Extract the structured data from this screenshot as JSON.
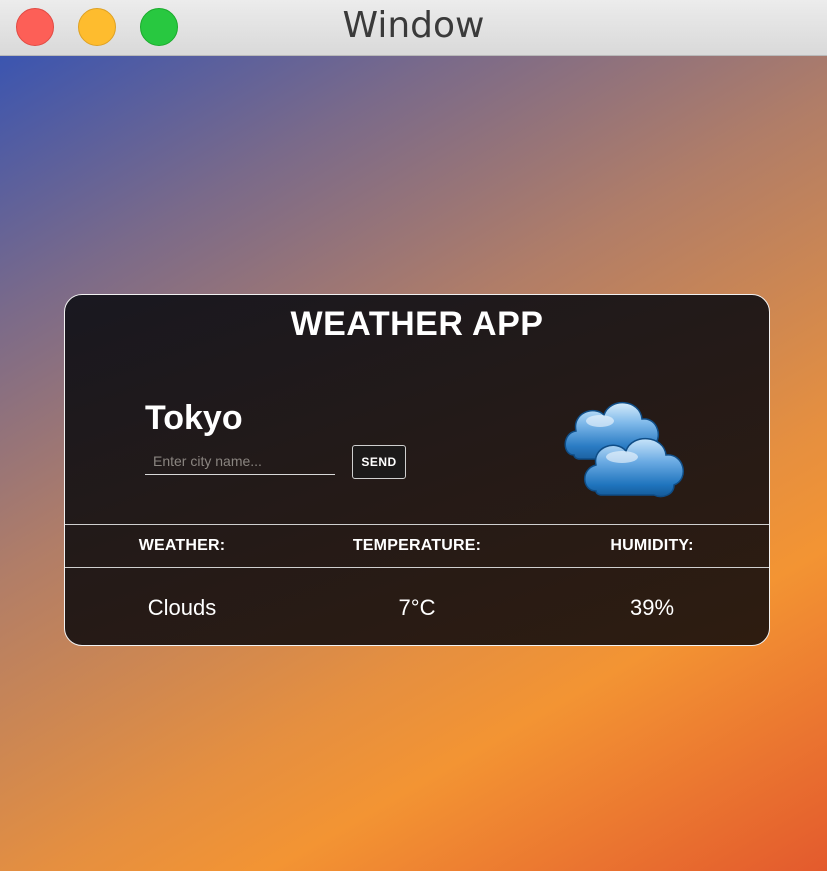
{
  "window": {
    "title": "Window"
  },
  "app": {
    "title": "WEATHER APP",
    "city": "Tokyo",
    "input_placeholder": "Enter city name...",
    "input_value": "",
    "send_label": "SEND",
    "weather_icon": "clouds-icon",
    "table": {
      "headers": [
        "WEATHER:",
        "TEMPERATURE:",
        "HUMIDITY:"
      ],
      "values": [
        "Clouds",
        "7°C",
        "39%"
      ]
    }
  },
  "colors": {
    "traffic_close": "#fd5f57",
    "traffic_minimize": "#febc2e",
    "traffic_maximize": "#28c840",
    "card_border": "#f2f2f2",
    "text": "#ffffff"
  }
}
